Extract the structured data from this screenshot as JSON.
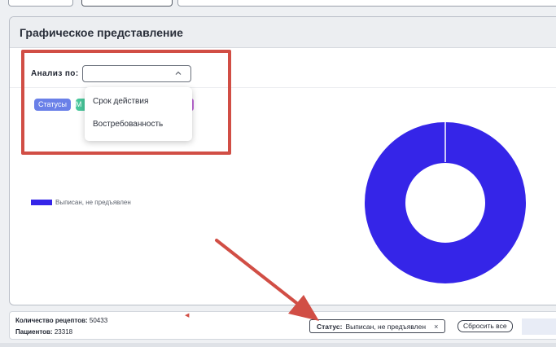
{
  "card": {
    "title": "Графическое представление"
  },
  "analysis": {
    "label": "Анализ по:",
    "selected_value": "",
    "options": [
      "Срок действия",
      "Востребованность"
    ]
  },
  "chips": {
    "status_label": "Статусы",
    "second_label": "М"
  },
  "legend": {
    "entry": "Выписан, не предъявлен"
  },
  "chart_data": {
    "type": "pie",
    "donut": true,
    "slices": [
      {
        "label": "Выписан, не предъявлен",
        "value": 100,
        "color": "#3525e8"
      }
    ]
  },
  "stats": {
    "recipes_label": "Количество рецептов:",
    "recipes_value": "50433",
    "patients_label": "Пациентов:",
    "patients_value": "23318"
  },
  "filter": {
    "status_key": "Статус:",
    "status_value": "Выписан, не предъявлен",
    "remove_symbol": "×",
    "reset_label": "Сбросить все"
  },
  "colors": {
    "accent_red": "#d14e45",
    "series_blue": "#3525e8"
  }
}
